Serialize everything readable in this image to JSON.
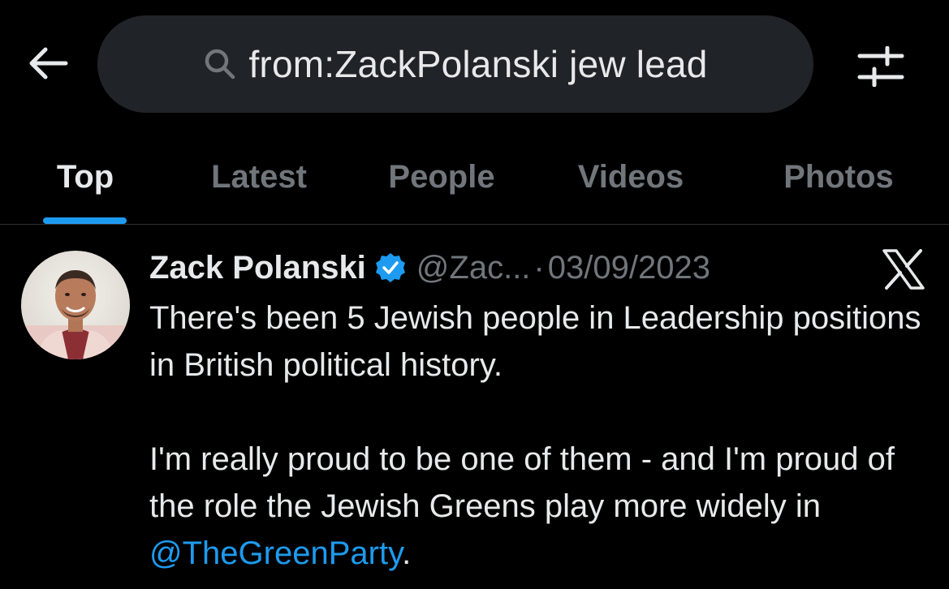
{
  "search": {
    "query": "from:ZackPolanski jew lead"
  },
  "tabs": [
    {
      "label": "Top",
      "active": true
    },
    {
      "label": "Latest",
      "active": false
    },
    {
      "label": "People",
      "active": false
    },
    {
      "label": "Videos",
      "active": false
    },
    {
      "label": "Photos",
      "active": false
    }
  ],
  "tweet": {
    "author_name": "Zack Polanski",
    "verified": true,
    "handle": "@Zac...",
    "separator": "·",
    "date": "03/09/2023",
    "paragraph1": "There's been 5 Jewish people in Leadership positions in British political history.",
    "paragraph2_text": "I'm really proud to be one of them - and I'm proud of the role the Jewish Greens play more widely in ",
    "mention": "@TheGreenParty",
    "paragraph2_end": "."
  },
  "icons": {
    "back": "arrow-left-icon",
    "search": "search-icon",
    "filter": "sliders-icon",
    "verified": "verified-badge-icon",
    "platform": "x-logo-icon"
  },
  "colors": {
    "background": "#000000",
    "text": "#e7e9ea",
    "muted": "#71767b",
    "accent": "#1d9bf0",
    "search_bg": "#202327"
  }
}
